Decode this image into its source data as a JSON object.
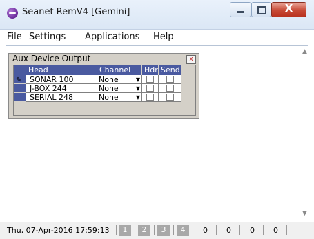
{
  "window": {
    "title": "Seanet RemV4 [Gemini]",
    "icon": "seanet-app-icon",
    "controls": {
      "minimize": "minimize",
      "maximize": "maximize",
      "close": "X"
    }
  },
  "menubar": {
    "items": [
      "File",
      "Settings",
      "Applications",
      "Help"
    ]
  },
  "aux_panel": {
    "title": "Aux Device Output",
    "close_label": "x",
    "columns": [
      "Head",
      "Channel",
      "Hdr",
      "Send"
    ],
    "rows": [
      {
        "head": "SONAR 100",
        "channel": "None",
        "hdr": false,
        "send": false,
        "editing": true
      },
      {
        "head": "J-BOX 244",
        "channel": "None",
        "hdr": false,
        "send": false,
        "editing": false
      },
      {
        "head": "SERIAL 248",
        "channel": "None",
        "hdr": false,
        "send": false,
        "editing": false
      }
    ]
  },
  "status": {
    "datetime": "Thu, 07-Apr-2016 17:59:13",
    "channels": [
      "1",
      "2",
      "3",
      "4"
    ],
    "values": [
      "0",
      "0",
      "0",
      "0"
    ]
  },
  "colors": {
    "header_blue": "#4a5aa0",
    "close_red": "#c74a36",
    "channel_gray": "#a8a8a8"
  }
}
